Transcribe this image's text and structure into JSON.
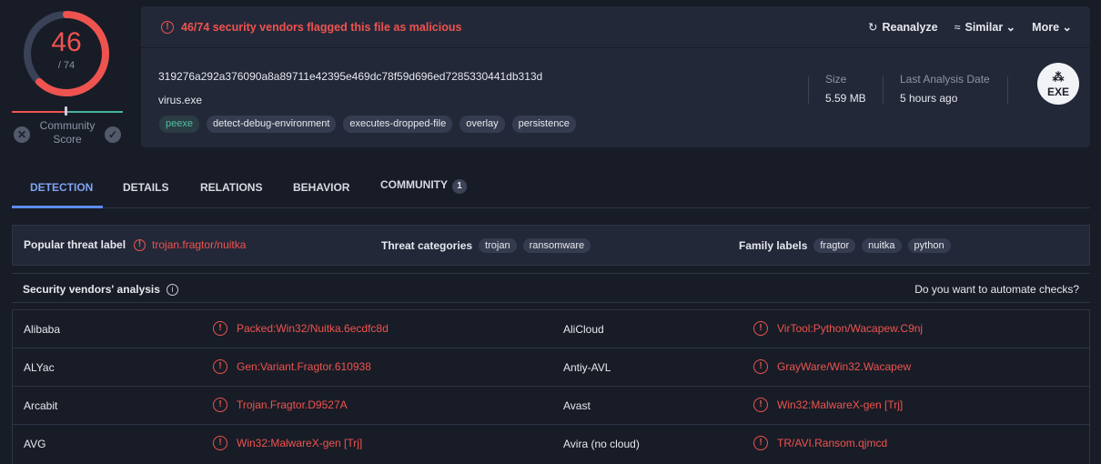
{
  "score": {
    "detected": "46",
    "total": "/ 74",
    "detected_fraction": 0.6216
  },
  "community": {
    "label_line1": "Community",
    "label_line2": "Score"
  },
  "alert": {
    "text": "46/74 security vendors flagged this file as malicious"
  },
  "actions": {
    "reanalyze": "Reanalyze",
    "similar": "Similar",
    "more": "More"
  },
  "file": {
    "hash": "319276a292a376090a8a89711e42395e469dc78f59d696ed7285330441db313d",
    "name": "virus.exe",
    "tags": [
      "peexe",
      "detect-debug-environment",
      "executes-dropped-file",
      "overlay",
      "persistence"
    ],
    "size_label": "Size",
    "size_value": "5.59 MB",
    "date_label": "Last Analysis Date",
    "date_value": "5 hours ago",
    "type_icon_text": "EXE"
  },
  "tabs": {
    "detection": "DETECTION",
    "details": "DETAILS",
    "relations": "RELATIONS",
    "behavior": "BEHAVIOR",
    "community": "COMMUNITY",
    "community_count": "1"
  },
  "threat": {
    "popular_label": "Popular threat label",
    "popular_value": "trojan.fragtor/nuitka",
    "categories_label": "Threat categories",
    "categories": [
      "trojan",
      "ransomware"
    ],
    "family_label": "Family labels",
    "families": [
      "fragtor",
      "nuitka",
      "python"
    ]
  },
  "vendors_header": {
    "title": "Security vendors' analysis",
    "automate": "Do you want to automate checks?"
  },
  "vendors": [
    {
      "left_name": "Alibaba",
      "left_result": "Packed:Win32/Nuitka.6ecdfc8d",
      "right_name": "AliCloud",
      "right_result": "VirTool:Python/Wacapew.C9nj"
    },
    {
      "left_name": "ALYac",
      "left_result": "Gen:Variant.Fragtor.610938",
      "right_name": "Antiy-AVL",
      "right_result": "GrayWare/Win32.Wacapew"
    },
    {
      "left_name": "Arcabit",
      "left_result": "Trojan.Fragtor.D9527A",
      "right_name": "Avast",
      "right_result": "Win32:MalwareX-gen [Trj]"
    },
    {
      "left_name": "AVG",
      "left_result": "Win32:MalwareX-gen [Trj]",
      "right_name": "Avira (no cloud)",
      "right_result": "TR/AVI.Ransom.qjmcd"
    }
  ],
  "colors": {
    "malicious": "#ef5350",
    "accent": "#5a8dee",
    "panel": "#232838",
    "background": "#181c26",
    "clean": "#45b39d"
  }
}
